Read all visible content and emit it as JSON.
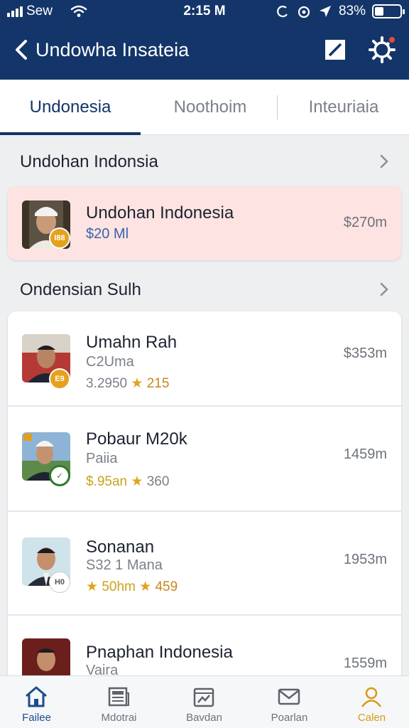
{
  "status_bar": {
    "carrier": "Sew",
    "time": "2:15 M",
    "battery": "83%"
  },
  "header": {
    "title": "Undowha Insateia",
    "icons": {
      "back": "chevron-left-icon",
      "edit": "edit-icon",
      "settings": "gear-icon"
    }
  },
  "tabs": [
    {
      "label": "Undonesia",
      "active": true
    },
    {
      "label": "Noothoim",
      "active": false
    },
    {
      "label": "Inteuriaia",
      "active": false
    }
  ],
  "sections": [
    {
      "title": "Undohan Indonsia"
    },
    {
      "title": "Ondensian Sulh"
    }
  ],
  "featured": {
    "name": "Undohan Indonesia",
    "amount": "$20 Ml",
    "price": "$270m",
    "badge": "I88"
  },
  "listings": [
    {
      "name": "Umahn Rah",
      "sub": "C2Uma",
      "rating_prefix": "3.2950",
      "score": "215",
      "price": "$353m",
      "badge": "E9",
      "badge_style": "gold"
    },
    {
      "name": "Pobaur M20k",
      "sub": "Paiia",
      "rating_prefix": "$.95an",
      "score": "360",
      "price": "1459m",
      "badge": "✓",
      "badge_style": "green"
    },
    {
      "name": "Sonanan",
      "sub": "S32 1 Mana",
      "rating_prefix": "50hm",
      "score": "459",
      "price": "1953m",
      "badge": "H0",
      "badge_style": "white"
    },
    {
      "name": "Pnaphan Indonesia",
      "sub": "Vaira",
      "price": "1559m"
    }
  ],
  "bottom_nav": [
    {
      "label": "Failee",
      "icon": "home-icon",
      "state": "active"
    },
    {
      "label": "Mdotrai",
      "icon": "news-icon",
      "state": ""
    },
    {
      "label": "Bavdan",
      "icon": "chart-icon",
      "state": ""
    },
    {
      "label": "Poarlan",
      "icon": "mail-icon",
      "state": ""
    },
    {
      "label": "Calen",
      "icon": "profile-icon",
      "state": "gold"
    }
  ],
  "colors": {
    "header_bg": "#143569",
    "accent_gold": "#e0a31c",
    "featured_bg": "#fde3e2",
    "notification": "#e8493b"
  }
}
